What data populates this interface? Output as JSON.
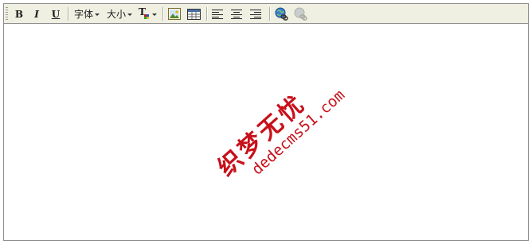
{
  "toolbar": {
    "bold_label": "B",
    "italic_label": "I",
    "underline_label": "U",
    "font_label": "字体",
    "size_label": "大小",
    "font_color_glyph": "T",
    "icons": {
      "image": "insert-image-icon",
      "table": "insert-table-icon",
      "align_left": "align-left-icon",
      "align_center": "align-center-icon",
      "align_right": "align-right-icon",
      "link": "insert-link-icon",
      "unlink": "remove-link-icon"
    }
  },
  "content": {
    "watermark_logo_text": "织梦无忧",
    "watermark_url_text": "dedecms51.com",
    "watermark_color": "#c8101a"
  },
  "colors": {
    "toolbar_bg": "#efefe2",
    "border": "#8e8e8e"
  }
}
